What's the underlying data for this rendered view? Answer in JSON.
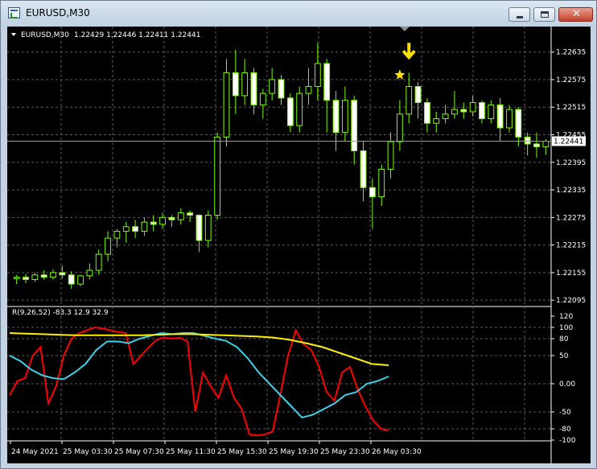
{
  "window": {
    "title": "EURUSD,M30"
  },
  "colors": {
    "background": "#000000",
    "grid": "#5a5a5a",
    "candle": "#7cfc00",
    "bull_body": "#000000",
    "bear_body": "#ffffff",
    "text": "#ffffff",
    "price_label_bg": "#ffffff",
    "price_label_text": "#000000",
    "red_line": "#ff0000",
    "cyan_line": "#3ecfe6",
    "yellow_line": "#ffee00",
    "star": "#ffe000",
    "arrow": "#ffe000"
  },
  "chart_data": [
    {
      "type": "candlestick",
      "symbol_label": "EURUSD,M30",
      "ohlc_label": "1.22429 1.22446 1.22411 1.22441",
      "current_price": 1.22441,
      "current_price_label": "1.22441",
      "ylim": [
        1.2209,
        1.2268
      ],
      "yticks": [
        "1.22635",
        "1.22575",
        "1.22515",
        "1.22455",
        "1.22395",
        "1.22335",
        "1.22275",
        "1.22215",
        "1.22155",
        "1.22095"
      ],
      "markers": [
        {
          "kind": "star",
          "index": 42,
          "price": 1.22585
        },
        {
          "kind": "down-arrow",
          "index": 43,
          "price": 1.2262
        }
      ],
      "candles": [
        [
          1.22142,
          1.2215,
          1.2213,
          1.22145
        ],
        [
          1.22145,
          1.22152,
          1.22132,
          1.2214
        ],
        [
          1.2214,
          1.22155,
          1.22135,
          1.2215
        ],
        [
          1.2215,
          1.2216,
          1.2214,
          1.22145
        ],
        [
          1.22145,
          1.22162,
          1.2214,
          1.22155
        ],
        [
          1.22155,
          1.2217,
          1.22142,
          1.2215
        ],
        [
          1.2215,
          1.22158,
          1.2212,
          1.2213
        ],
        [
          1.2213,
          1.2215,
          1.22125,
          1.22148
        ],
        [
          1.22148,
          1.22175,
          1.2214,
          1.2216
        ],
        [
          1.2216,
          1.22205,
          1.2215,
          1.22195
        ],
        [
          1.22195,
          1.22245,
          1.2218,
          1.2223
        ],
        [
          1.2223,
          1.2225,
          1.2221,
          1.22245
        ],
        [
          1.22245,
          1.22265,
          1.2222,
          1.22255
        ],
        [
          1.22255,
          1.2227,
          1.2223,
          1.22245
        ],
        [
          1.22245,
          1.22275,
          1.22235,
          1.22265
        ],
        [
          1.22265,
          1.2228,
          1.22245,
          1.2226
        ],
        [
          1.2226,
          1.22285,
          1.2225,
          1.22275
        ],
        [
          1.22275,
          1.2228,
          1.22255,
          1.2227
        ],
        [
          1.2227,
          1.22295,
          1.2226,
          1.22285
        ],
        [
          1.22285,
          1.2229,
          1.22265,
          1.2228
        ],
        [
          1.2228,
          1.22282,
          1.222,
          1.22225
        ],
        [
          1.22225,
          1.2229,
          1.2221,
          1.2228
        ],
        [
          1.2228,
          1.2246,
          1.2227,
          1.2245
        ],
        [
          1.2245,
          1.2262,
          1.2243,
          1.2259
        ],
        [
          1.2259,
          1.2264,
          1.225,
          1.2254
        ],
        [
          1.2254,
          1.2262,
          1.2252,
          1.2259
        ],
        [
          1.2259,
          1.226,
          1.225,
          1.2252
        ],
        [
          1.2252,
          1.22555,
          1.2249,
          1.22545
        ],
        [
          1.22545,
          1.226,
          1.2253,
          1.22575
        ],
        [
          1.22575,
          1.22585,
          1.2252,
          1.22535
        ],
        [
          1.22535,
          1.22545,
          1.2246,
          1.22475
        ],
        [
          1.22475,
          1.2256,
          1.2246,
          1.22545
        ],
        [
          1.22545,
          1.226,
          1.2252,
          1.2256
        ],
        [
          1.2256,
          1.22655,
          1.2253,
          1.2261
        ],
        [
          1.2261,
          1.2262,
          1.2246,
          1.2253
        ],
        [
          1.2253,
          1.2255,
          1.2242,
          1.2246
        ],
        [
          1.2246,
          1.2256,
          1.2244,
          1.2253
        ],
        [
          1.2253,
          1.2254,
          1.2239,
          1.2242
        ],
        [
          1.2242,
          1.2244,
          1.2231,
          1.2234
        ],
        [
          1.2234,
          1.2236,
          1.2225,
          1.2232
        ],
        [
          1.2232,
          1.2239,
          1.223,
          1.2238
        ],
        [
          1.2238,
          1.2246,
          1.2236,
          1.2244
        ],
        [
          1.2244,
          1.2253,
          1.2242,
          1.225
        ],
        [
          1.225,
          1.2259,
          1.2248,
          1.2256
        ],
        [
          1.2256,
          1.2257,
          1.2249,
          1.22525
        ],
        [
          1.22525,
          1.22535,
          1.2246,
          1.2248
        ],
        [
          1.2248,
          1.22505,
          1.2246,
          1.2249
        ],
        [
          1.2249,
          1.2252,
          1.2248,
          1.225
        ],
        [
          1.225,
          1.2255,
          1.2249,
          1.2251
        ],
        [
          1.2251,
          1.22525,
          1.2249,
          1.22505
        ],
        [
          1.22505,
          1.2254,
          1.22495,
          1.22525
        ],
        [
          1.22525,
          1.2253,
          1.2248,
          1.2249
        ],
        [
          1.2249,
          1.2253,
          1.2248,
          1.2252
        ],
        [
          1.2252,
          1.22535,
          1.2244,
          1.2247
        ],
        [
          1.2247,
          1.2252,
          1.2246,
          1.2251
        ],
        [
          1.2251,
          1.22515,
          1.2243,
          1.2245
        ],
        [
          1.2245,
          1.2246,
          1.2241,
          1.22435
        ],
        [
          1.22435,
          1.2246,
          1.22405,
          1.22429
        ],
        [
          1.22429,
          1.22446,
          1.22411,
          1.22441
        ]
      ]
    },
    {
      "type": "line",
      "indicator_label": "R(9,26,52) -83.3 12.9 32.9",
      "ylim": [
        -100,
        120
      ],
      "yticks": [
        "120",
        "100",
        "80",
        "50",
        "0.00",
        "-50",
        "-80",
        "-100"
      ],
      "series": [
        {
          "color": "red",
          "values": [
            -20,
            5,
            10,
            50,
            65,
            -35,
            -5,
            50,
            80,
            90,
            95,
            100,
            98,
            95,
            92,
            90,
            35,
            50,
            65,
            78,
            82,
            80,
            82,
            75,
            -50,
            20,
            -5,
            -25,
            15,
            -25,
            -45,
            -90,
            -92,
            -90,
            -85,
            -20,
            50,
            95,
            70,
            60,
            30,
            -15,
            -30,
            20,
            30,
            -10,
            -40,
            -65,
            -80,
            -83.3
          ]
        },
        {
          "color": "cyan",
          "values": [
            50,
            40,
            25,
            15,
            10,
            8,
            20,
            35,
            60,
            75,
            75,
            72,
            80,
            85,
            90,
            88,
            90,
            90,
            85,
            80,
            76,
            65,
            45,
            20,
            0,
            -20,
            -40,
            -60,
            -55,
            -45,
            -35,
            -20,
            -15,
            0,
            5,
            12.9
          ]
        },
        {
          "color": "yellow",
          "values": [
            90,
            89,
            88,
            87,
            86,
            86,
            86,
            86,
            86,
            87,
            88,
            88,
            87,
            86,
            85,
            84,
            82,
            78,
            72,
            65,
            55,
            45,
            35,
            32.9
          ]
        }
      ]
    }
  ],
  "time_axis": [
    "24 May 2021",
    "25 May 03:30",
    "25 May 07:30",
    "25 May 11:30",
    "25 May 15:30",
    "25 May 19:30",
    "25 May 23:30",
    "26 May 03:30"
  ]
}
